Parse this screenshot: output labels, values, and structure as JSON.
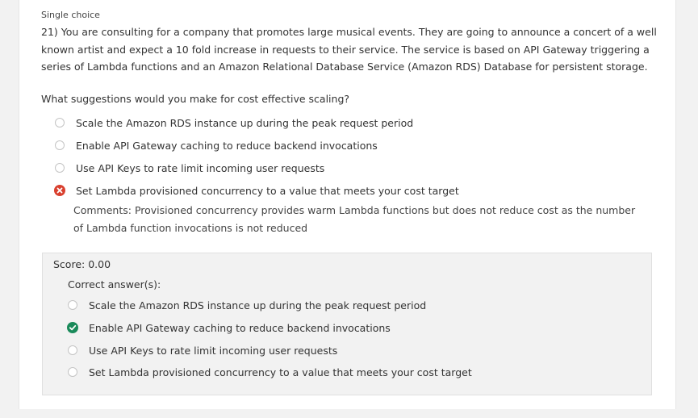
{
  "question": {
    "type_label": "Single choice",
    "stem": "21) You are consulting for a company that promotes large musical events. They are going to announce a concert of a well known artist and expect a 10 fold increase in requests to their service. The service is based on API Gateway triggering a series of Lambda functions and an Amazon Relational Database Service (Amazon RDS) Database for persistent storage.",
    "ask": "What suggestions would you make for cost effective scaling?",
    "options": [
      {
        "label": "Scale the Amazon RDS instance up during the peak request period",
        "state": "unselected"
      },
      {
        "label": "Enable API Gateway caching to reduce backend invocations",
        "state": "unselected"
      },
      {
        "label": "Use API Keys to rate limit incoming user requests",
        "state": "unselected"
      },
      {
        "label": "Set Lambda provisioned concurrency to a value that meets your cost target",
        "state": "selected-incorrect",
        "icon": "x-circle-icon"
      }
    ],
    "comments": "Comments: Provisioned concurrency provides warm Lambda functions but does not reduce cost as the number of Lambda function invocations is not reduced"
  },
  "result": {
    "score": "Score: 0.00",
    "correct_title": "Correct answer(s):",
    "options": [
      {
        "label": "Scale the Amazon RDS instance up during the peak request period",
        "state": "empty"
      },
      {
        "label": "Enable API Gateway caching to reduce backend invocations",
        "state": "correct",
        "icon": "check-circle-icon"
      },
      {
        "label": "Use API Keys to rate limit incoming user requests",
        "state": "empty"
      },
      {
        "label": "Set Lambda provisioned concurrency to a value that meets your cost target",
        "state": "empty"
      }
    ]
  },
  "colors": {
    "incorrect": "#d9402f",
    "correct": "#1a8a5a",
    "panel_bg": "#f2f2f2",
    "radio_border": "#c4c4c4"
  }
}
